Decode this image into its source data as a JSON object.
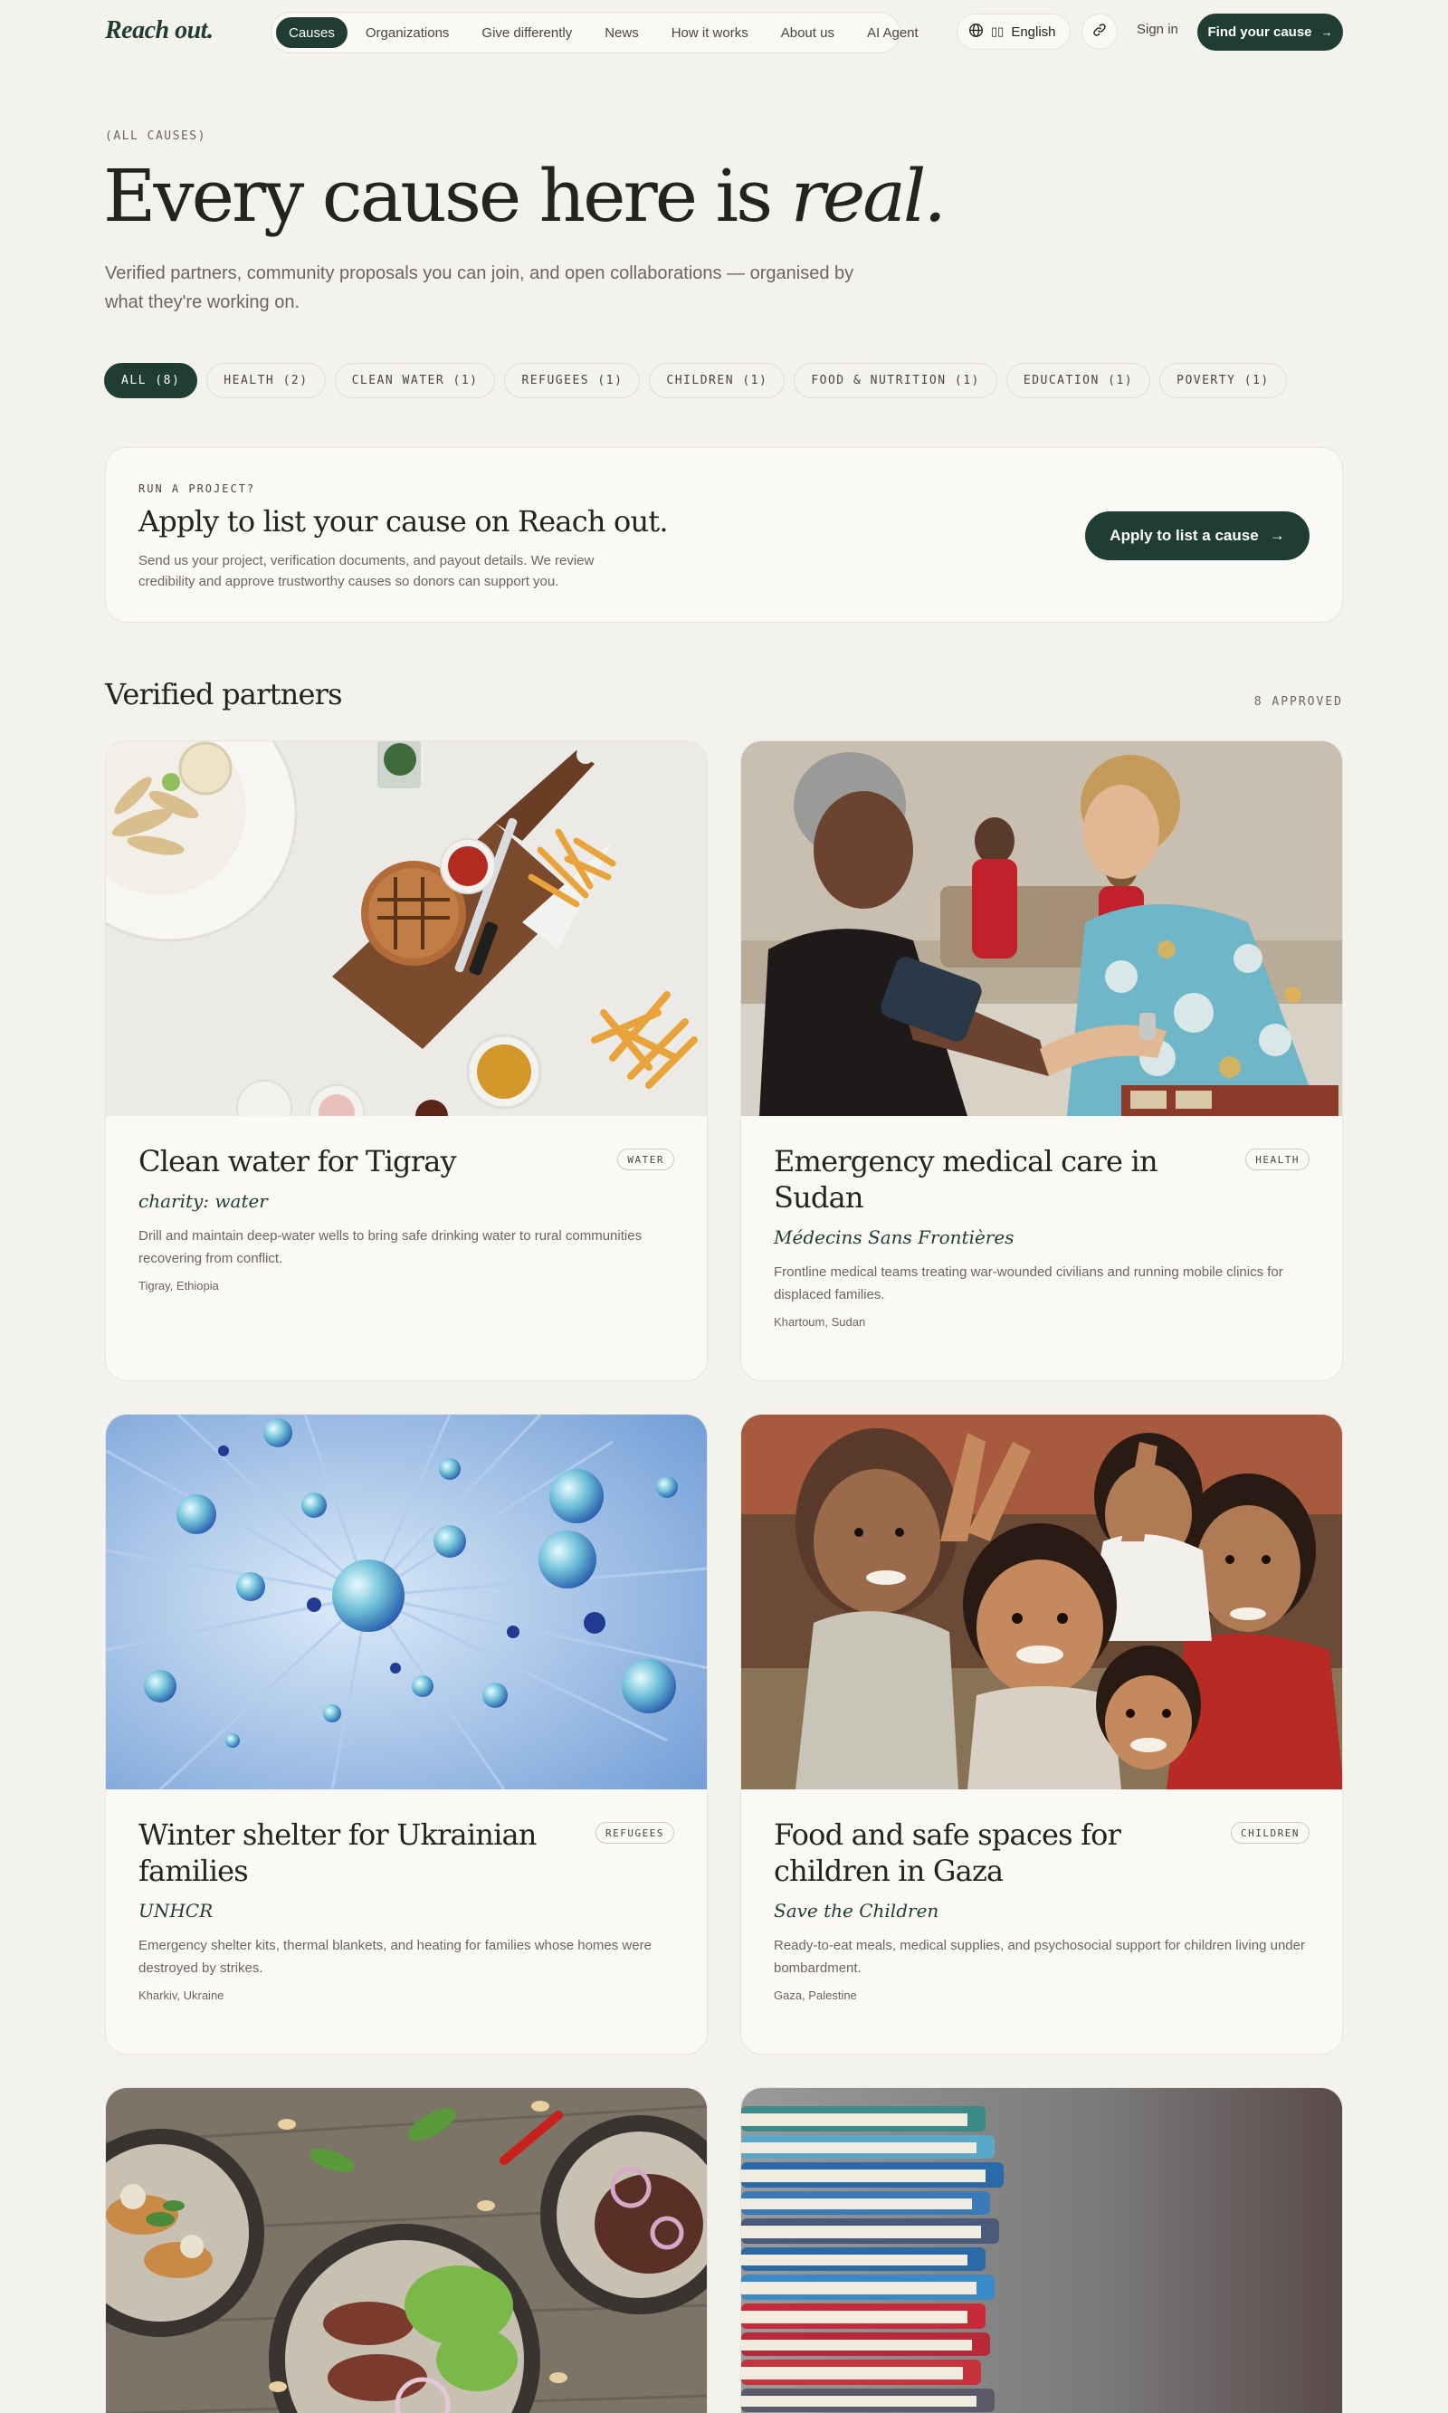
{
  "nav": {
    "logo": "Reach out.",
    "links": [
      "Causes",
      "Organizations",
      "Give differently",
      "News",
      "How it works",
      "About us",
      "AI Agent"
    ],
    "language": "English",
    "language_flag": "▯▯",
    "sign_in": "Sign in",
    "cta": "Find your cause",
    "cta_arrow": "→",
    "icons": [
      "globe-icon",
      "link-icon"
    ]
  },
  "hero": {
    "eyebrow": "(ALL CAUSES)",
    "title_main": "Every cause here is ",
    "title_em": "real.",
    "subtitle": "Verified partners, community proposals you can join, and open collaborations — organised by what they're working on."
  },
  "filters": [
    "ALL (8)",
    "HEALTH (2)",
    "CLEAN WATER (1)",
    "REFUGEES (1)",
    "CHILDREN (1)",
    "FOOD & NUTRITION (1)",
    "EDUCATION (1)",
    "POVERTY (1)"
  ],
  "apply": {
    "eyebrow": "RUN A PROJECT?",
    "title": "Apply to list your cause on Reach out.",
    "description": "Send us your project, verification documents, and payout details. We review credibility and approve trustworthy causes so donors can support you.",
    "button": "Apply to list a cause",
    "button_arrow": "→"
  },
  "partners": {
    "title": "Verified partners",
    "count": "8 APPROVED",
    "cards": [
      {
        "title": "Clean water for Tigray",
        "tag": "WATER",
        "org": "charity: water",
        "description": "Drill and maintain deep-water wells to bring safe drinking water to rural communities recovering from conflict.",
        "location": "Tigray, Ethiopia",
        "image": "food-platter-photo"
      },
      {
        "title": "Emergency medical care in Sudan",
        "tag": "HEALTH",
        "org": "Médecins Sans Frontières",
        "description": "Frontline medical teams treating war-wounded civilians and running mobile clinics for displaced families.",
        "location": "Khartoum, Sudan",
        "image": "blood-pressure-clinic-photo"
      },
      {
        "title": "Winter shelter for Ukrainian families",
        "tag": "REFUGEES",
        "org": "UNHCR",
        "description": "Emergency shelter kits, thermal blankets, and heating for families whose homes were destroyed by strikes.",
        "location": "Kharkiv, Ukraine",
        "image": "blue-molecule-abstract"
      },
      {
        "title": "Food and safe spaces for children in Gaza",
        "tag": "CHILDREN",
        "org": "Save the Children",
        "description": "Ready-to-eat meals, medical supplies, and psychosocial support for children living under bombardment.",
        "location": "Gaza, Palestine",
        "image": "smiling-children-photo"
      }
    ],
    "more_images": [
      "asian-dishes-photo",
      "stacked-books-photo"
    ]
  }
}
